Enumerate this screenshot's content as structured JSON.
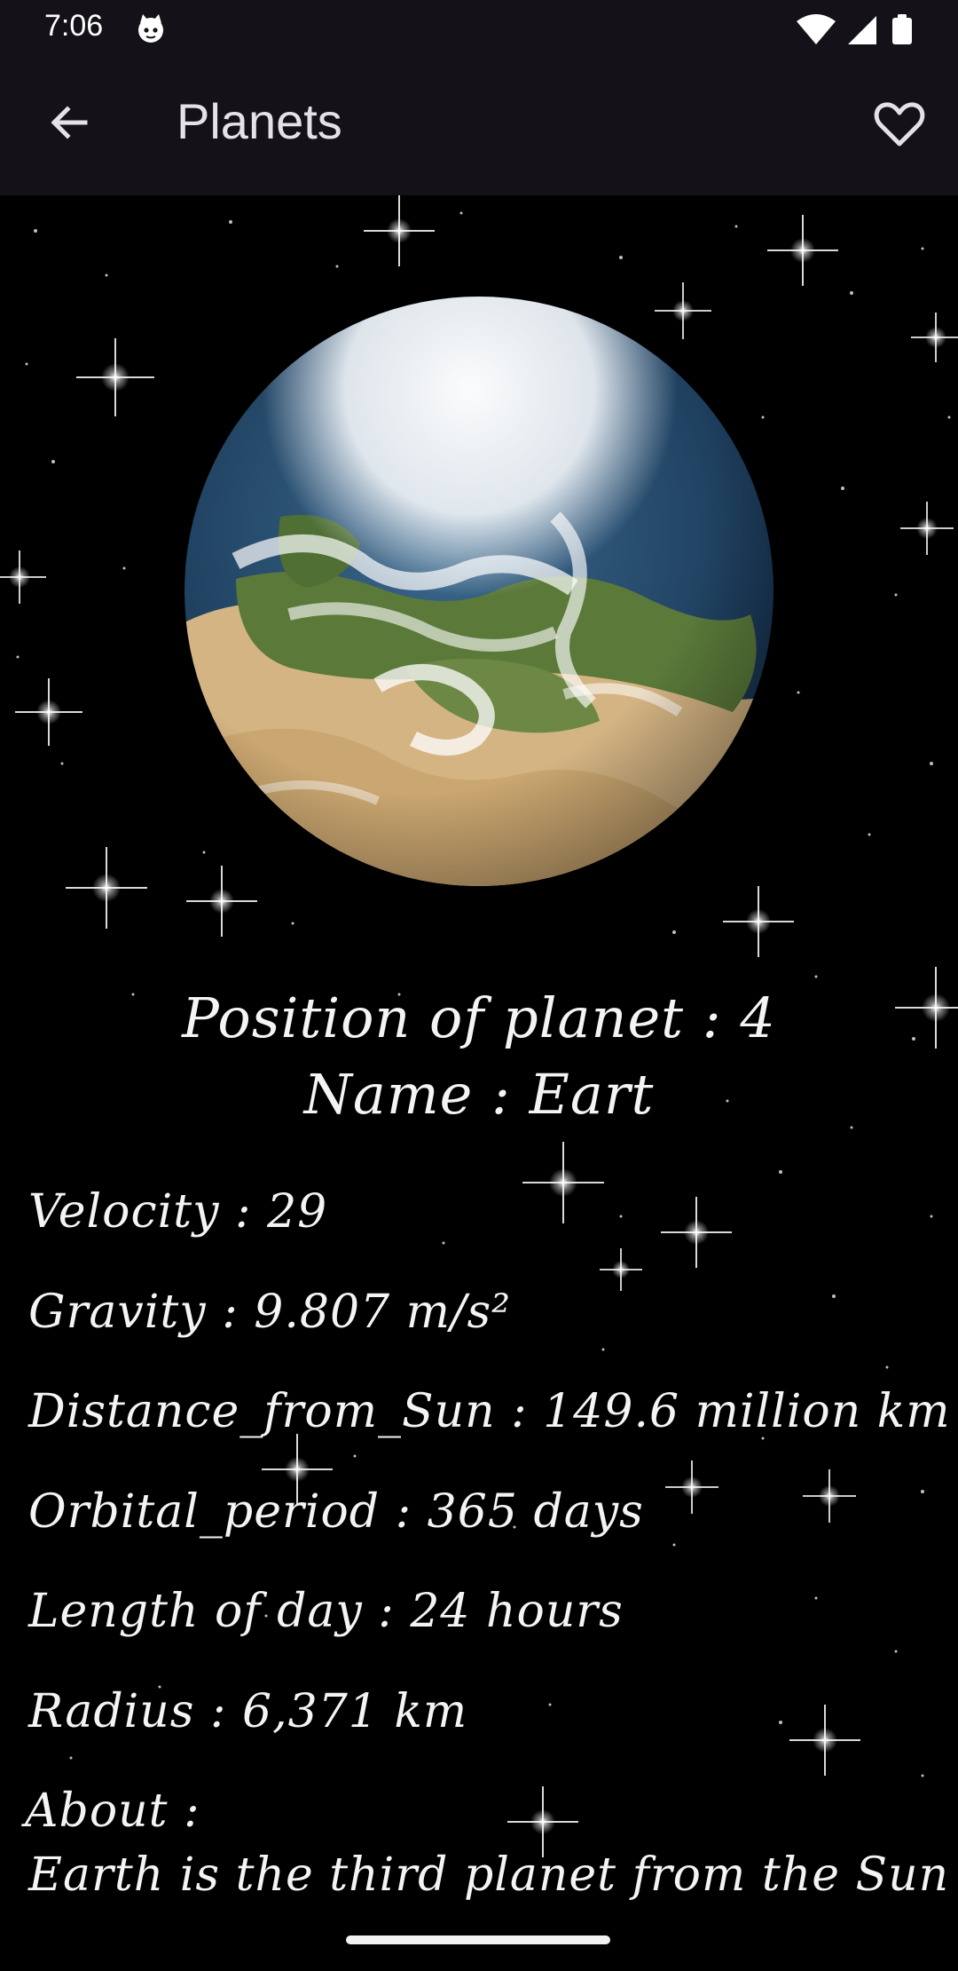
{
  "status_bar": {
    "time": "7:06"
  },
  "app_bar": {
    "title": "Planets",
    "back_icon": "arrow-left-icon",
    "favorite_icon": "heart-outline-icon"
  },
  "planet": {
    "position_label": "Position of planet : 4",
    "name_label": "Name : Eart",
    "stats": [
      {
        "text": "Velocity : 29"
      },
      {
        "text": "Gravity : 9.807 m/s²"
      },
      {
        "text": "Distance_from_Sun : 149.6 million km"
      },
      {
        "text": "Orbital_period : 365 days"
      },
      {
        "text": "Length of day : 24 hours"
      },
      {
        "text": "Radius : 6,371 km"
      }
    ],
    "about_label": "About :",
    "about_text": "Earth is the third planet from the Sun"
  }
}
